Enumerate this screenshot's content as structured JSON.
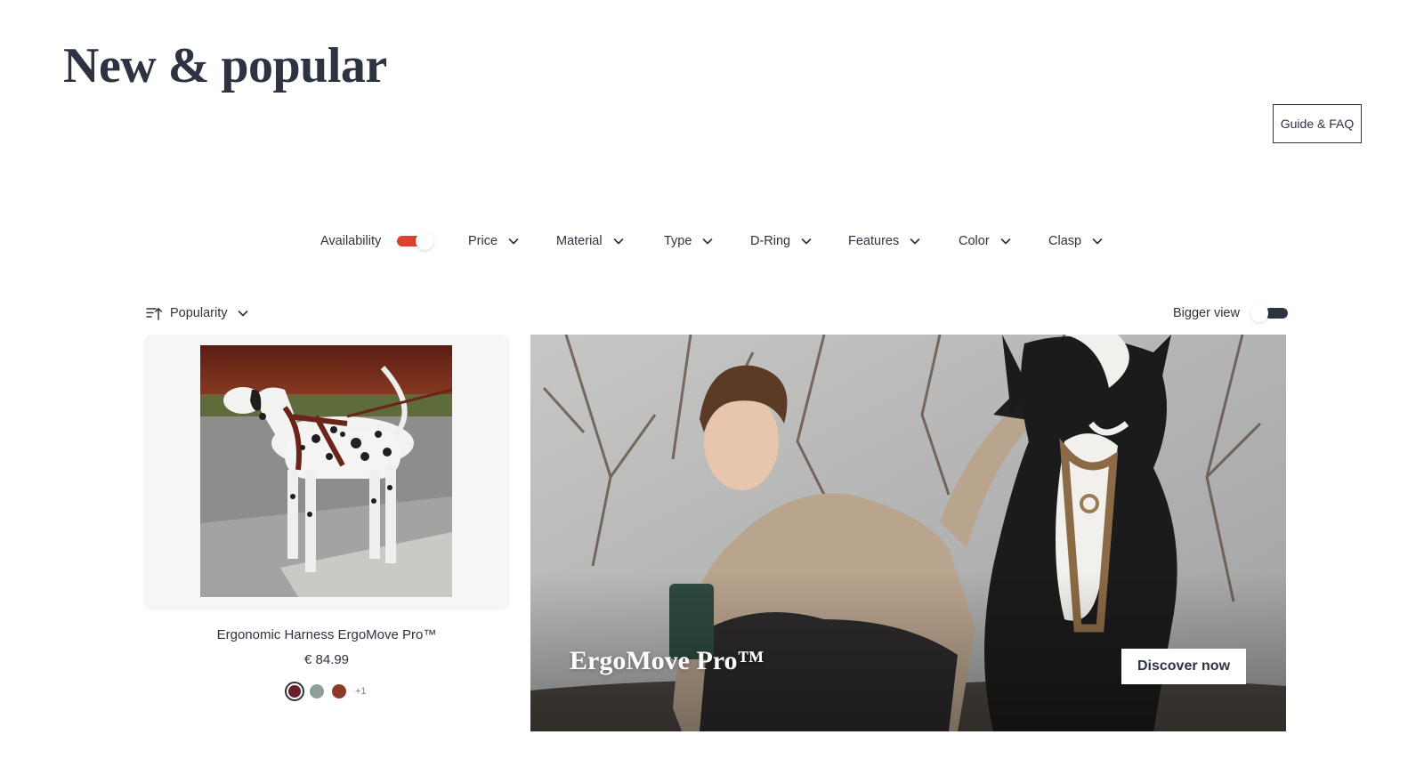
{
  "page": {
    "title": "New & popular",
    "guide_button": "Guide & FAQ"
  },
  "filters": {
    "availability": {
      "label": "Availability",
      "enabled": true
    },
    "items": [
      {
        "label": "Price"
      },
      {
        "label": "Material"
      },
      {
        "label": "Type"
      },
      {
        "label": "D-Ring"
      },
      {
        "label": "Features"
      },
      {
        "label": "Color"
      },
      {
        "label": "Clasp"
      }
    ]
  },
  "sort": {
    "label": "Popularity"
  },
  "bigger_view": {
    "label": "Bigger view",
    "enabled": false
  },
  "product": {
    "name": "Ergonomic Harness ErgoMove Pro™",
    "price": "€ 84.99",
    "swatches": [
      {
        "color": "#6b1f2c",
        "selected": true
      },
      {
        "color": "#8e9f98",
        "selected": false
      },
      {
        "color": "#8c3a2b",
        "selected": false
      }
    ],
    "more_colors": "+1"
  },
  "hero": {
    "title": "ErgoMove Pro™",
    "button": "Discover now"
  },
  "colors": {
    "text": "#2d3340",
    "accent_red": "#d9432f",
    "card_bg": "#f6f6f6"
  },
  "icons": {
    "sort": "sort-ascending-icon",
    "chevron": "chevron-down-icon"
  }
}
